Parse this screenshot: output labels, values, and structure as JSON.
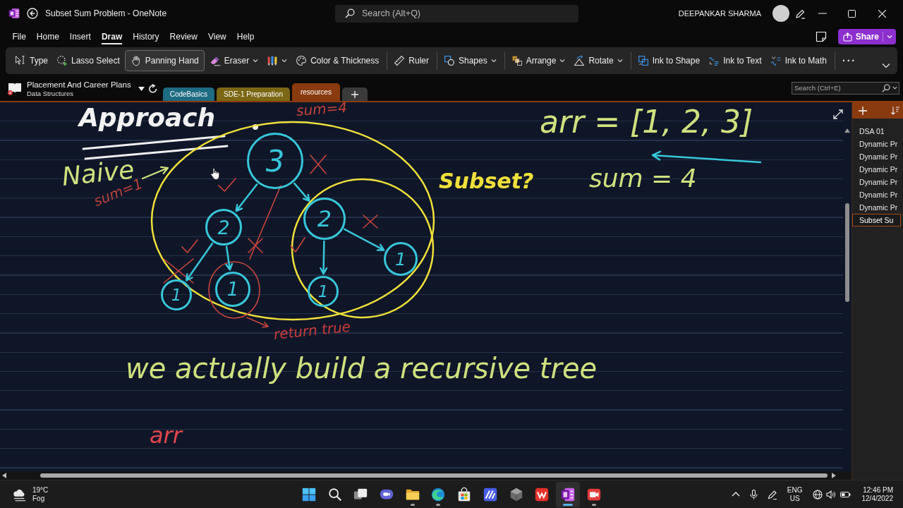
{
  "window": {
    "title": "Subset Sum Problem - OneNote"
  },
  "search": {
    "placeholder": "Search (Alt+Q)"
  },
  "account": {
    "name": "DEEPANKAR SHARMA"
  },
  "menu": [
    {
      "label": "File",
      "selected": false
    },
    {
      "label": "Home",
      "selected": false
    },
    {
      "label": "Insert",
      "selected": false
    },
    {
      "label": "Draw",
      "selected": true
    },
    {
      "label": "History",
      "selected": false
    },
    {
      "label": "Review",
      "selected": false
    },
    {
      "label": "View",
      "selected": false
    },
    {
      "label": "Help",
      "selected": false
    }
  ],
  "share": {
    "label": "Share"
  },
  "ribbon": {
    "groups": [
      [
        {
          "kind": "button",
          "label": "Type",
          "selected": false,
          "dropdown": false
        },
        {
          "kind": "button",
          "label": "Lasso Select",
          "selected": false,
          "dropdown": false
        },
        {
          "kind": "button",
          "label": "Panning Hand",
          "selected": true,
          "dropdown": false
        },
        {
          "kind": "button",
          "label": "Eraser",
          "selected": false,
          "dropdown": true
        },
        {
          "kind": "icon",
          "selected": false,
          "dropdown": true
        },
        {
          "kind": "button",
          "label": "Color & Thickness",
          "selected": false,
          "dropdown": false
        }
      ],
      [
        {
          "kind": "button",
          "label": "Ruler",
          "selected": false,
          "dropdown": false
        }
      ],
      [
        {
          "kind": "button",
          "label": "Shapes",
          "selected": false,
          "dropdown": true
        }
      ],
      [
        {
          "kind": "button",
          "label": "Arrange",
          "selected": false,
          "dropdown": true
        },
        {
          "kind": "button",
          "label": "Rotate",
          "selected": false,
          "dropdown": true
        }
      ],
      [
        {
          "kind": "button",
          "label": "Ink to Shape",
          "selected": false,
          "dropdown": false
        },
        {
          "kind": "button",
          "label": "Ink to Text",
          "selected": false,
          "dropdown": false
        },
        {
          "kind": "button",
          "label": "Ink to Math",
          "selected": false,
          "dropdown": false
        }
      ],
      [
        {
          "kind": "more",
          "label": "···"
        }
      ]
    ]
  },
  "notebook": {
    "name": "Placement And Career Plans",
    "section_group": "Data Structures"
  },
  "section_tabs": [
    {
      "label": "CodeBasics",
      "color": "#1e6b82",
      "selected": false
    },
    {
      "label": "SDE-1 Preparation",
      "color": "#7b6714",
      "selected": false
    },
    {
      "label": "resources",
      "color": "#8a3a0f",
      "selected": true
    }
  ],
  "section_search": {
    "placeholder": "Search (Ctrl+E)"
  },
  "canvas": {
    "ink_texts": [
      {
        "text": "Approach",
        "color": "#f2f2f2"
      },
      {
        "text": "Naive",
        "color": "#cfe17e"
      },
      {
        "text": "sum=4",
        "color": "#c2443a"
      },
      {
        "text": "sum=1",
        "color": "#b9433b"
      },
      {
        "text": "Subset?",
        "color": "#efe03a"
      },
      {
        "text": "return true",
        "color": "#c93c3c"
      },
      {
        "text": "arr = [1, 2, 3]",
        "color": "#cfe17e"
      },
      {
        "text": "sum = 4",
        "color": "#cfe17e"
      },
      {
        "text": "we actually build a recursive tree",
        "color": "#cfe17e"
      },
      {
        "text": "arr",
        "color": "#e0464c"
      }
    ],
    "tree": {
      "label": "3",
      "children": [
        {
          "label": "2",
          "children": [
            {
              "label": "1"
            },
            {
              "label": "1"
            }
          ]
        },
        {
          "label": "2",
          "children": [
            {
              "label": "1"
            },
            {
              "label": "1"
            }
          ]
        }
      ]
    }
  },
  "pages": [
    {
      "title": "DSA 01",
      "selected": false
    },
    {
      "title": "Dynamic Pr",
      "selected": false
    },
    {
      "title": "Dynamic Pr",
      "selected": false
    },
    {
      "title": "Dynamic Pr",
      "selected": false
    },
    {
      "title": "Dynamic Pr",
      "selected": false
    },
    {
      "title": "Dynamic Pr",
      "selected": false
    },
    {
      "title": "Dynamic Pr",
      "selected": false
    },
    {
      "title": "Subset Su",
      "selected": true
    }
  ],
  "taskbar": {
    "weather": {
      "temperature": "19°C",
      "condition": "Fog"
    },
    "apps": [
      {
        "running": false,
        "active": false
      },
      {
        "running": false,
        "active": false
      },
      {
        "running": false,
        "active": false
      },
      {
        "running": false,
        "active": false
      },
      {
        "running": true,
        "active": false
      },
      {
        "running": true,
        "active": false
      },
      {
        "running": false,
        "active": false
      },
      {
        "running": false,
        "active": false
      },
      {
        "running": false,
        "active": false
      },
      {
        "running": false,
        "active": false
      },
      {
        "running": true,
        "active": true
      },
      {
        "running": true,
        "active": false
      }
    ],
    "language": {
      "code": "ENG",
      "region": "US"
    },
    "clock": {
      "time": "12:46 PM",
      "date": "12/4/2022"
    }
  }
}
